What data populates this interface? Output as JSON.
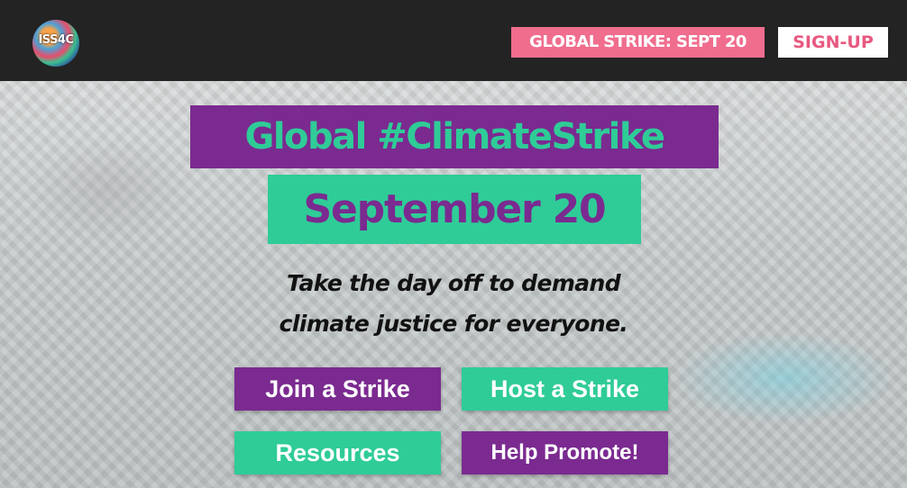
{
  "header": {
    "logo_text": "ISS4C",
    "nav": {
      "strike_label": "GLOBAL STRIKE: SEPT 20",
      "signup_label": "SIGN-UP"
    }
  },
  "hero": {
    "title_line1": "Global #ClimateStrike",
    "title_line2": "September 20",
    "tagline_line1": "Take the day off to demand",
    "tagline_line2": "climate justice for everyone.",
    "buttons": {
      "join": "Join a Strike",
      "host": "Host a Strike",
      "resources": "Resources",
      "promote": "Help Promote!"
    }
  },
  "colors": {
    "purple": "#7b2a90",
    "green": "#2fcc97",
    "pink": "#f06d8e",
    "header_bg": "#232323"
  }
}
